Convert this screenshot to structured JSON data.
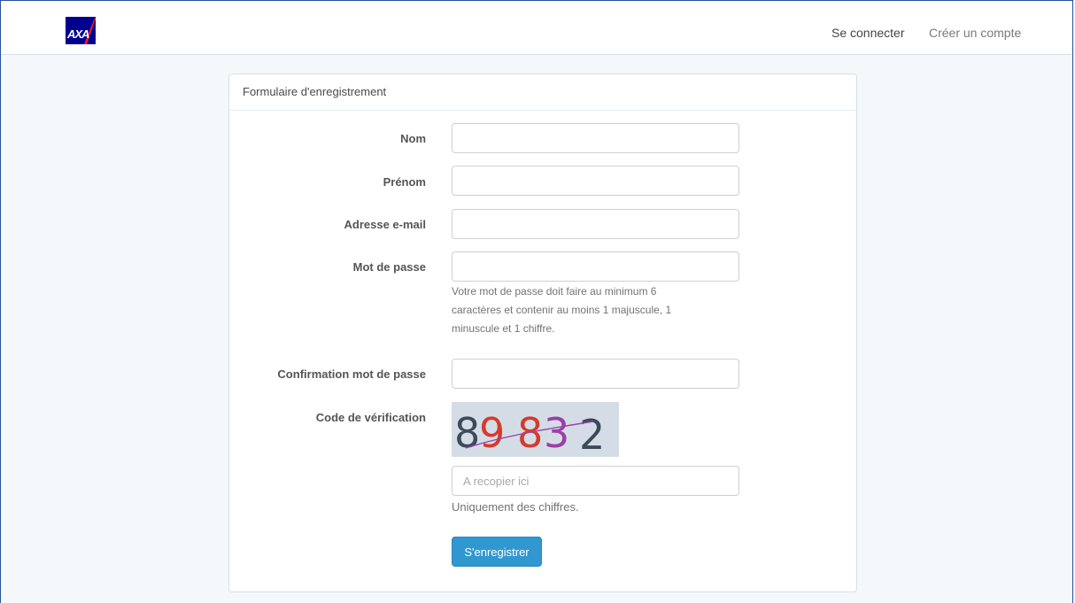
{
  "navbar": {
    "logo_text": "AXA",
    "login_label": "Se connecter",
    "register_label": "Créer un compte"
  },
  "panel": {
    "heading": "Formulaire d'enregistrement"
  },
  "form": {
    "nom": {
      "label": "Nom",
      "value": ""
    },
    "prenom": {
      "label": "Prénom",
      "value": ""
    },
    "email": {
      "label": "Adresse e-mail",
      "value": ""
    },
    "password": {
      "label": "Mot de passe",
      "value": "",
      "help_line1": "Votre mot de passe doit faire au minimum 6",
      "help_line2": "caractères et contenir au moins 1 majuscule, 1",
      "help_line3": "minuscule et 1 chiffre."
    },
    "password_confirm": {
      "label": "Confirmation mot de passe",
      "value": ""
    },
    "captcha": {
      "label": "Code de vérification",
      "image_text": "89832",
      "placeholder": "A recopier ici",
      "help": "Uniquement des chiffres."
    },
    "submit_label": "S'enregistrer"
  },
  "colors": {
    "accent": "#3097d1",
    "logo_blue": "#00008f",
    "logo_red": "#ff1721",
    "captcha_dark": "#3c4a5a",
    "captcha_red": "#d63a2c",
    "captcha_purple": "#9c3ea8"
  }
}
